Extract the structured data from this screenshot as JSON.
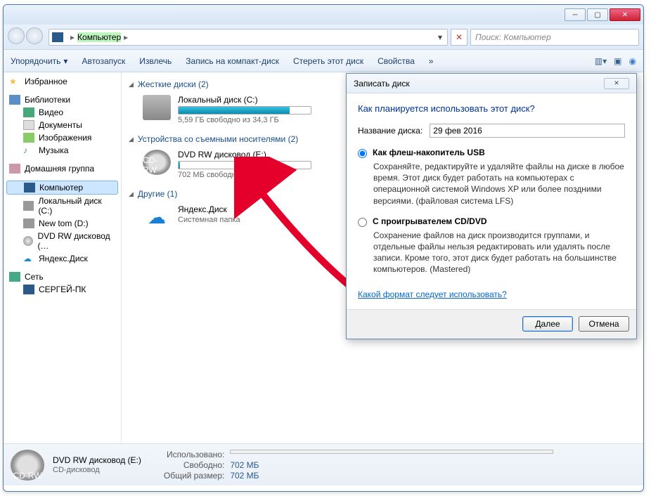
{
  "breadcrumb": {
    "root": "Компьютер"
  },
  "search": {
    "placeholder": "Поиск: Компьютер"
  },
  "toolbar": {
    "organize": "Упорядочить",
    "autoplay": "Автозапуск",
    "eject": "Извлечь",
    "burn": "Запись на компакт-диск",
    "erase": "Стереть этот диск",
    "properties": "Свойства"
  },
  "nav": {
    "favorites": "Избранное",
    "libraries": "Библиотеки",
    "lib_items": {
      "video": "Видео",
      "docs": "Документы",
      "images": "Изображения",
      "music": "Музыка"
    },
    "homegroup": "Домашняя группа",
    "computer": "Компьютер",
    "comp_items": {
      "c": "Локальный диск (C:)",
      "d": "New tom (D:)",
      "e": "DVD RW дисковод (…",
      "y": "Яндекс.Диск"
    },
    "network": "Сеть",
    "net_items": {
      "pc": "СЕРГЕЙ-ПК"
    }
  },
  "groups": {
    "hdd": {
      "title": "Жесткие диски (2)"
    },
    "removable": {
      "title": "Устройства со съемными носителями (2)"
    },
    "other": {
      "title": "Другие (1)"
    }
  },
  "drives": {
    "c": {
      "name": "Локальный диск (C:)",
      "free": "5,59 ГБ свободно из 34,3 ГБ",
      "fill_pct": 84
    },
    "dvd": {
      "name": "DVD RW дисковод (E:)",
      "free": "702 МБ свободно из 702 МБ",
      "fill_pct": 1,
      "badge": "CD-RW"
    },
    "ydisk": {
      "name": "Яндекс.Диск",
      "sub": "Системная папка"
    }
  },
  "status": {
    "title": "DVD RW дисковод (E:)",
    "sub": "CD-дисковод",
    "used_lbl": "Использовано:",
    "free_lbl": "Свободно:",
    "free_val": "702 МБ",
    "total_lbl": "Общий размер:",
    "total_val": "702 МБ",
    "badge": "CD-RW"
  },
  "dialog": {
    "title": "Записать диск",
    "question": "Как планируется использовать этот диск?",
    "name_lbl": "Название диска:",
    "name_val": "29 фев 2016",
    "opt1_title": "Как флеш-накопитель USB",
    "opt1_desc": "Сохраняйте, редактируйте и удаляйте файлы на диске в любое время. Этот диск будет работать на компьютерах с операционной системой Windows XP или более поздними версиями. (файловая система LFS)",
    "opt2_title": "С проигрывателем CD/DVD",
    "opt2_desc": "Сохранение файлов на диск производится группами, и отдельные файлы нельзя редактировать или удалять после записи. Кроме того, этот диск будет работать на большинстве компьютеров. (Mastered)",
    "help_link": "Какой формат следует использовать?",
    "next": "Далее",
    "cancel": "Отмена"
  }
}
